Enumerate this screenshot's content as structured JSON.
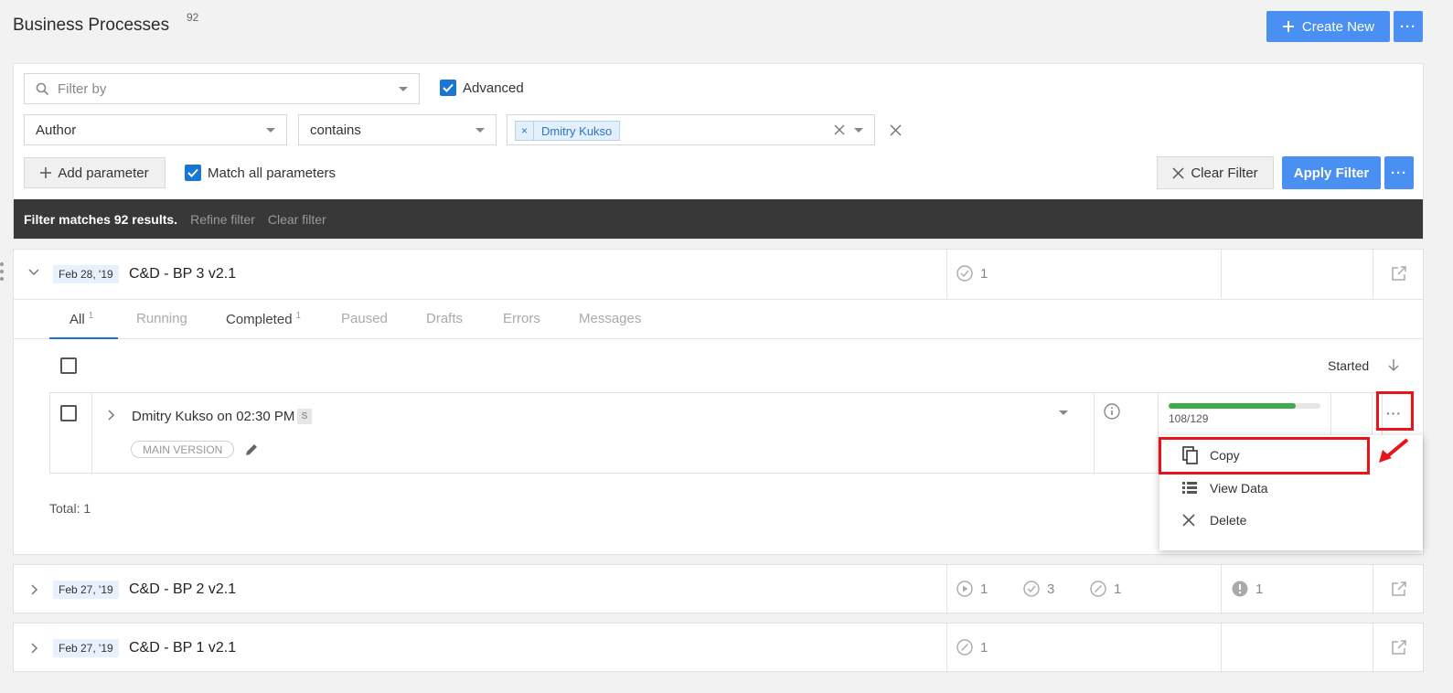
{
  "header": {
    "title": "Business Processes",
    "count": "92",
    "create_label": "Create New"
  },
  "filter": {
    "search_placeholder": "Filter by",
    "advanced_label": "Advanced",
    "param_field": "Author",
    "param_operator": "contains",
    "param_value_chip": "Dmitry Kukso",
    "add_parameter_label": "Add parameter",
    "match_all_label": "Match all parameters",
    "clear_filter_label": "Clear Filter",
    "apply_filter_label": "Apply Filter",
    "result_text": "Filter matches 92 results.",
    "refine_link": "Refine filter",
    "clear_link": "Clear filter"
  },
  "processes": [
    {
      "date": "Feb 28, '19",
      "name": "C&D - BP 3 v2.1",
      "completed": "1"
    },
    {
      "date": "Feb 27, '19",
      "name": "C&D - BP 2 v2.1",
      "running": "1",
      "completed": "3",
      "paused": "1",
      "errors": "1"
    },
    {
      "date": "Feb 27, '19",
      "name": "C&D - BP 1 v2.1",
      "paused": "1"
    }
  ],
  "tabs": [
    {
      "label": "All",
      "count": "1"
    },
    {
      "label": "Running"
    },
    {
      "label": "Completed",
      "count": "1"
    },
    {
      "label": "Paused"
    },
    {
      "label": "Drafts"
    },
    {
      "label": "Errors"
    },
    {
      "label": "Messages"
    }
  ],
  "list": {
    "sort_label": "Started",
    "total": "Total: 1"
  },
  "instance": {
    "name": "Dmitry Kukso on 02:30 PM",
    "badge": "S",
    "version": "MAIN VERSION",
    "progress_text": "108/129",
    "progress_fraction": 0.837
  },
  "context_menu": {
    "copy": "Copy",
    "view_data": "View Data",
    "delete": "Delete"
  },
  "colors": {
    "accent": "#4a8ff2",
    "progress": "#3eaa48",
    "highlight": "#e8141a"
  }
}
